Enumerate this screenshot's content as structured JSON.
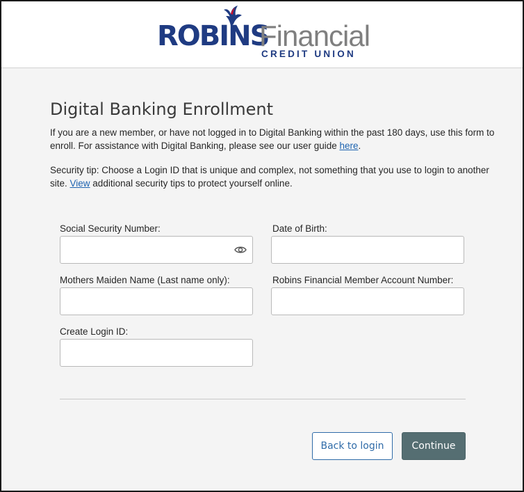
{
  "brand": {
    "name_bold": "ROBINS",
    "name_light": "Financial",
    "sub": "CREDIT UNION",
    "primary_color": "#1f3b82",
    "accent_color": "#c8102e"
  },
  "page": {
    "title": "Digital Banking Enrollment",
    "intro_text": "If you are a new member, or have not logged in to Digital Banking within the past 180 days, use this form to enroll. For assistance with Digital Banking, please see our user guide ",
    "intro_link": "here",
    "intro_end": ".",
    "tip_text": "Security tip: Choose a Login ID that is unique and complex, not something that you use to login to another site. ",
    "tip_link": "View",
    "tip_end": " additional security tips to protect yourself online."
  },
  "form": {
    "ssn_label": "Social Security Number:",
    "ssn_value": "",
    "dob_label": "Date of Birth:",
    "dob_value": "",
    "maiden_label": "Mothers Maiden Name (Last name only):",
    "maiden_value": "",
    "account_label": "Robins Financial Member Account Number:",
    "account_value": "",
    "login_label": "Create Login ID:",
    "login_value": "",
    "ssn_toggle_icon": "eye-icon"
  },
  "actions": {
    "back_label": "Back to login",
    "continue_label": "Continue"
  }
}
